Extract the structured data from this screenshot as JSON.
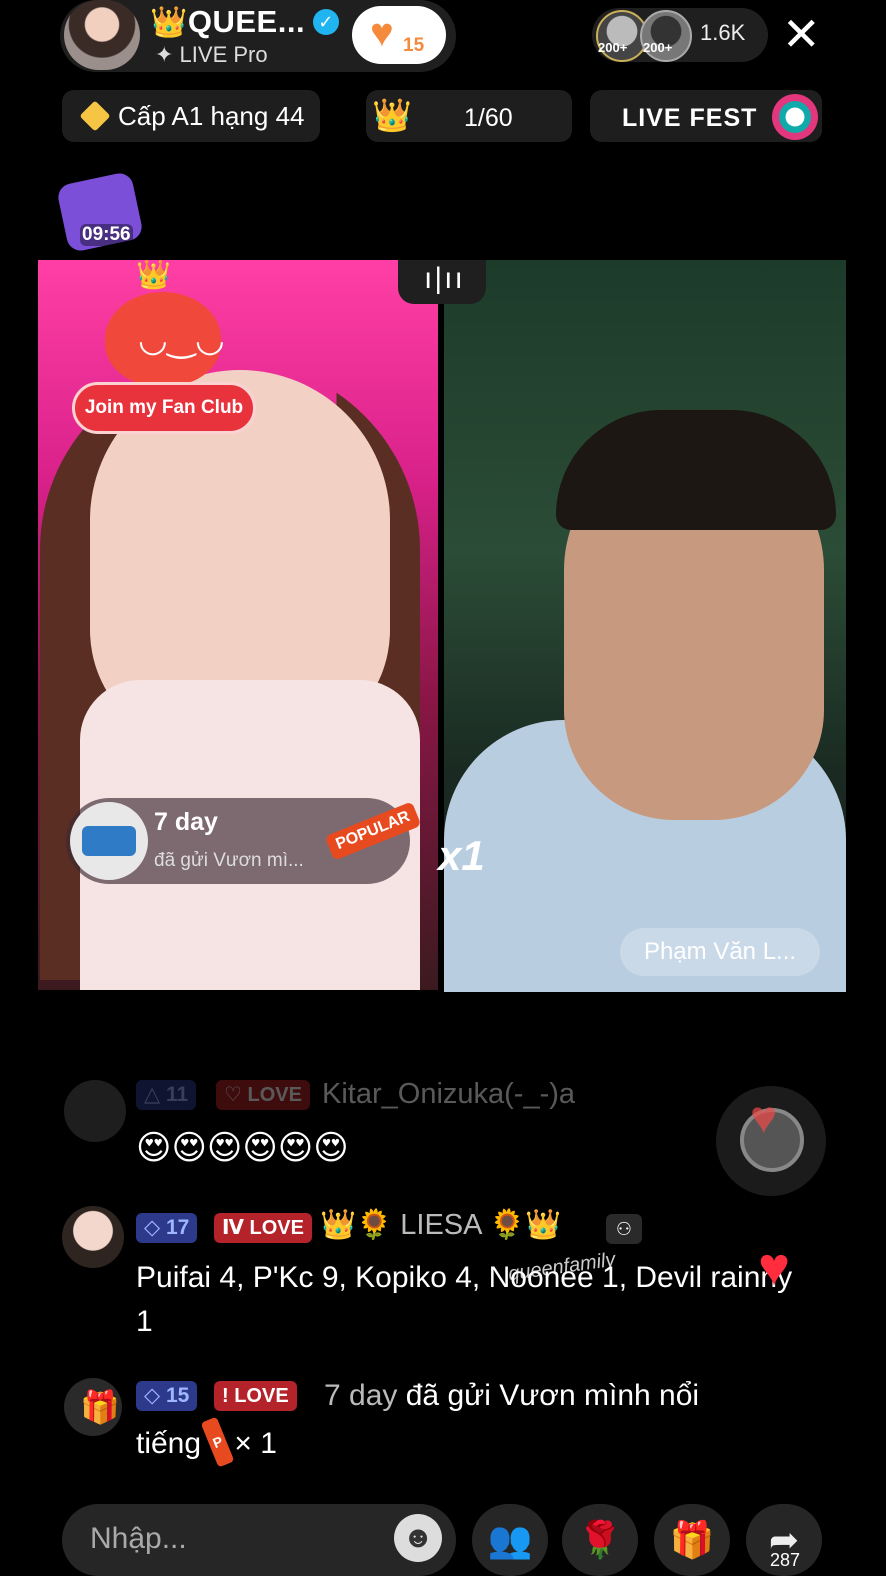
{
  "header": {
    "host_name": "QUEE...",
    "host_crown": "👑",
    "host_subtitle": "✦ LIVE Pro",
    "follow_count": "15",
    "viewer_badge_1": "200+",
    "viewer_badge_2": "200+",
    "viewer_count": "1.6K",
    "close_glyph": "✕"
  },
  "chips": {
    "rank_label": "Cấp A1 hạng 44",
    "progress": "1/60",
    "fest_label": "LIVE FEST"
  },
  "gift_box": {
    "timer": "09:56"
  },
  "battle": {
    "fan_club_label": "Join my Fan Club",
    "audio_glyph": "ı|ıı",
    "gift_title": "7 day",
    "gift_sub": "đã gửi Vươn mì...",
    "gift_popular": "POPULAR",
    "gift_multiplier": "x1",
    "opponent_name": "Phạm Văn L..."
  },
  "comments": [
    {
      "level": "11",
      "love": "LOVE",
      "name": "Kitar_Onizuka(-_-)a",
      "text": "😍😍😍😍😍😍"
    },
    {
      "level": "17",
      "love": "LOVE",
      "name": "👑🌻 LIESA 🌻👑",
      "text": "Puifai 4, P'Kc 9, Kopiko 4, Noonee 1, Devil rainny 1"
    },
    {
      "level": "15",
      "love": "LOVE",
      "name": "7 day",
      "text_main": "đã gửi Vươn mình nổi",
      "text_line2": "tiếng",
      "text_mult": "× 1"
    }
  ],
  "watermark": "queenfamily",
  "bottom": {
    "input_placeholder": "Nhập...",
    "emoji_glyph": "☻",
    "share_count": "287"
  },
  "icons": {
    "verified": "verified-check-icon",
    "heart": "heart-icon",
    "close": "close-icon",
    "diamond": "diamond-icon",
    "gift": "gift-icon",
    "share": "share-icon"
  },
  "colors": {
    "love_badge": "#b4232a",
    "level_badge": "#2d3a8c",
    "follow_heart": "#f58a3c",
    "verified": "#20b5f0"
  }
}
